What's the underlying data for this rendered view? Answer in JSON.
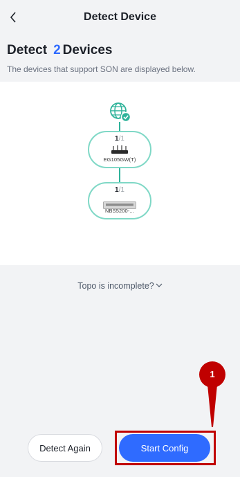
{
  "header": {
    "title": "Detect Device"
  },
  "detect": {
    "prefix": "Detect",
    "count": "2",
    "suffix": "Devices",
    "subtitle": "The devices that support SON are displayed below."
  },
  "topology": {
    "nodes": [
      {
        "used": "1",
        "sep": "/",
        "total": "1",
        "name": "EG105GW(T)"
      },
      {
        "used": "1",
        "sep": "/",
        "total": "1",
        "name": "NBS5200-..."
      }
    ]
  },
  "topo_link": "Topo is incomplete?",
  "buttons": {
    "detect_again": "Detect Again",
    "start_config": "Start Config"
  },
  "annotation": {
    "number": "1"
  },
  "colors": {
    "accent": "#2f6bff",
    "teal": "#2fb39a",
    "callout": "#c00000"
  }
}
